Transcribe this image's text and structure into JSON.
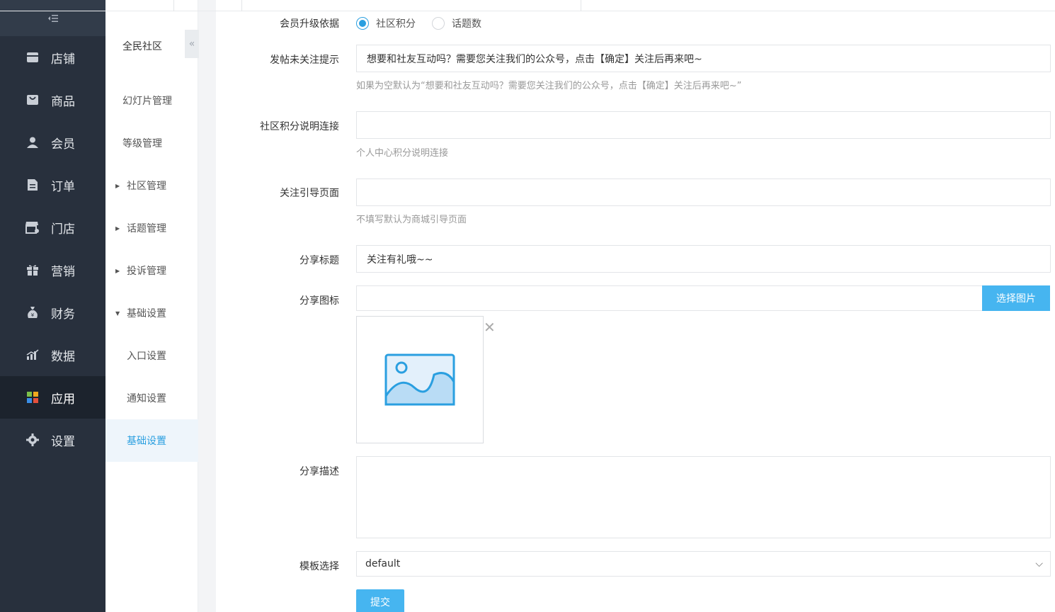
{
  "nav": {
    "toggle_icon": "collapse-menu-icon",
    "items": [
      {
        "label": "店铺",
        "icon": "store-icon"
      },
      {
        "label": "商品",
        "icon": "goods-icon"
      },
      {
        "label": "会员",
        "icon": "member-icon"
      },
      {
        "label": "订单",
        "icon": "order-icon"
      },
      {
        "label": "门店",
        "icon": "shop-icon"
      },
      {
        "label": "营销",
        "icon": "gift-icon"
      },
      {
        "label": "财务",
        "icon": "money-bag-icon"
      },
      {
        "label": "数据",
        "icon": "bar-chart-icon"
      },
      {
        "label": "应用",
        "icon": "apps-icon",
        "active": true
      },
      {
        "label": "设置",
        "icon": "gear-icon"
      }
    ]
  },
  "subnav": {
    "title": "全民社区",
    "items": [
      {
        "label": "幻灯片管理"
      },
      {
        "label": "等级管理"
      },
      {
        "label": "社区管理"
      },
      {
        "label": "话题管理"
      },
      {
        "label": "投诉管理"
      },
      {
        "label": "基础设置"
      },
      {
        "label": "入口设置"
      },
      {
        "label": "通知设置"
      },
      {
        "label": "基础设置",
        "active": true
      }
    ]
  },
  "form": {
    "upgrade": {
      "label": "会员升级依据",
      "options": [
        "社区积分",
        "话题数"
      ],
      "selected": "社区积分"
    },
    "follow_tip": {
      "label": "发帖未关注提示",
      "value": "想要和社友互动吗？需要您关注我们的公众号，点击【确定】关注后再来吧~",
      "help": "如果为空默认为“想要和社友互动吗？需要您关注我们的公众号，点击【确定】关注后再来吧~”"
    },
    "points_link": {
      "label": "社区积分说明连接",
      "value": "",
      "help": "个人中心积分说明连接"
    },
    "follow_page": {
      "label": "关注引导页面",
      "value": "",
      "help": "不填写默认为商城引导页面"
    },
    "share_title": {
      "label": "分享标题",
      "value": "关注有礼哦~~"
    },
    "share_icon": {
      "label": "分享图标",
      "value": "",
      "button": "选择图片"
    },
    "share_desc": {
      "label": "分享描述",
      "value": ""
    },
    "template": {
      "label": "模板选择",
      "value": "default"
    },
    "submit": "提交"
  },
  "colors": {
    "accent": "#46b5f0",
    "nav_bg": "#28303d",
    "active_text": "#2a9fe0"
  }
}
